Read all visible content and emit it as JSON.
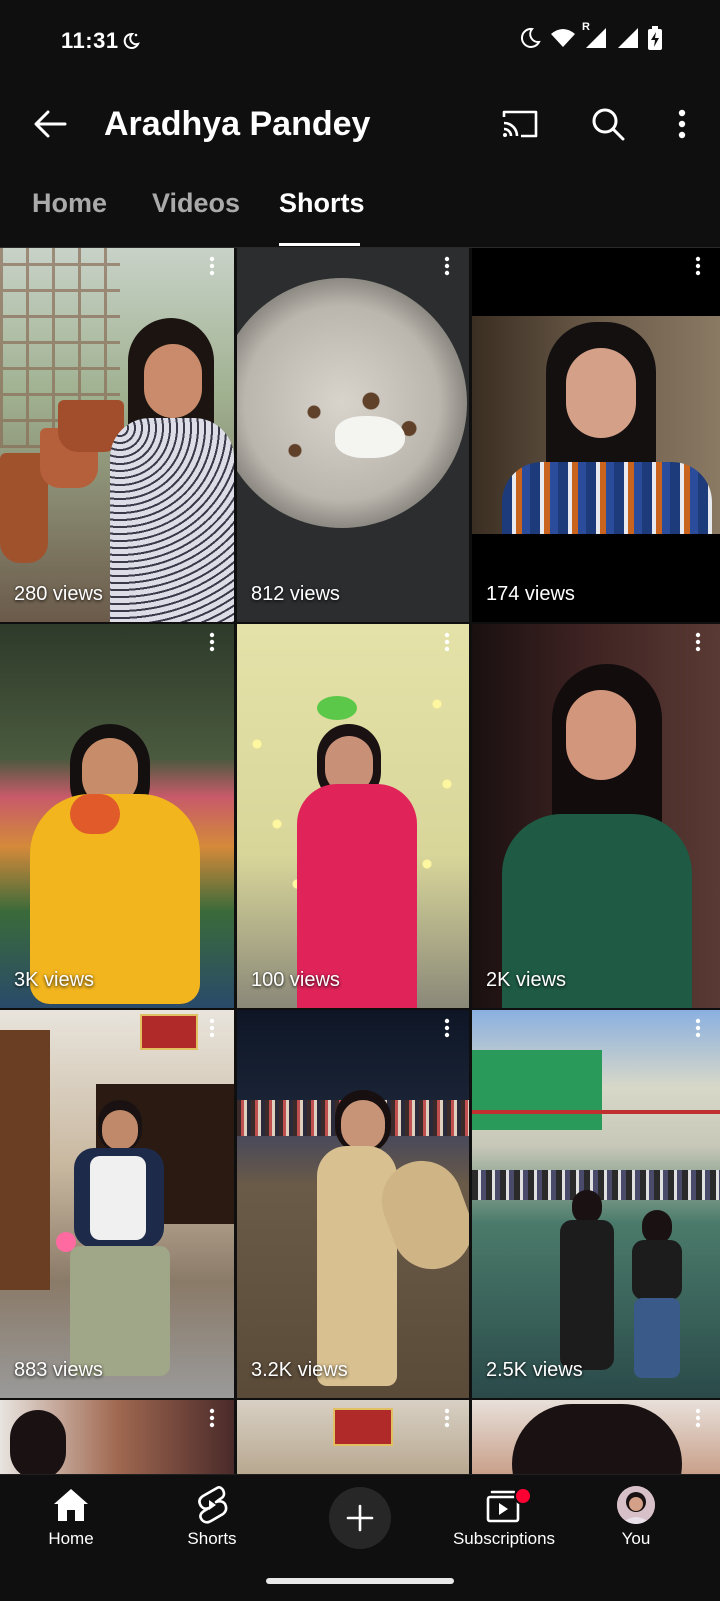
{
  "status_bar": {
    "time": "11:31",
    "network_badge": "R"
  },
  "app_bar": {
    "title": "Aradhya Pandey"
  },
  "tabs": [
    {
      "label": "Home"
    },
    {
      "label": "Videos"
    },
    {
      "label": "Shorts",
      "active": true
    }
  ],
  "shorts": [
    {
      "views": "280 views"
    },
    {
      "views": "812 views"
    },
    {
      "views": "174 views"
    },
    {
      "views": "3K views"
    },
    {
      "views": "100 views"
    },
    {
      "views": "2K views"
    },
    {
      "views": "883 views"
    },
    {
      "views": "3.2K views"
    },
    {
      "views": "2.5K views"
    }
  ],
  "bottom_nav": [
    {
      "label": "Home",
      "icon": "home-icon"
    },
    {
      "label": "Shorts",
      "icon": "shorts-icon"
    },
    {
      "label": "",
      "icon": "plus-icon"
    },
    {
      "label": "Subscriptions",
      "icon": "subscriptions-icon"
    },
    {
      "label": "You",
      "icon": "avatar"
    }
  ],
  "colors": {
    "background": "#0f0f0f",
    "notification_dot": "#ff0033",
    "inactive_tab": "#aaaaaa"
  }
}
